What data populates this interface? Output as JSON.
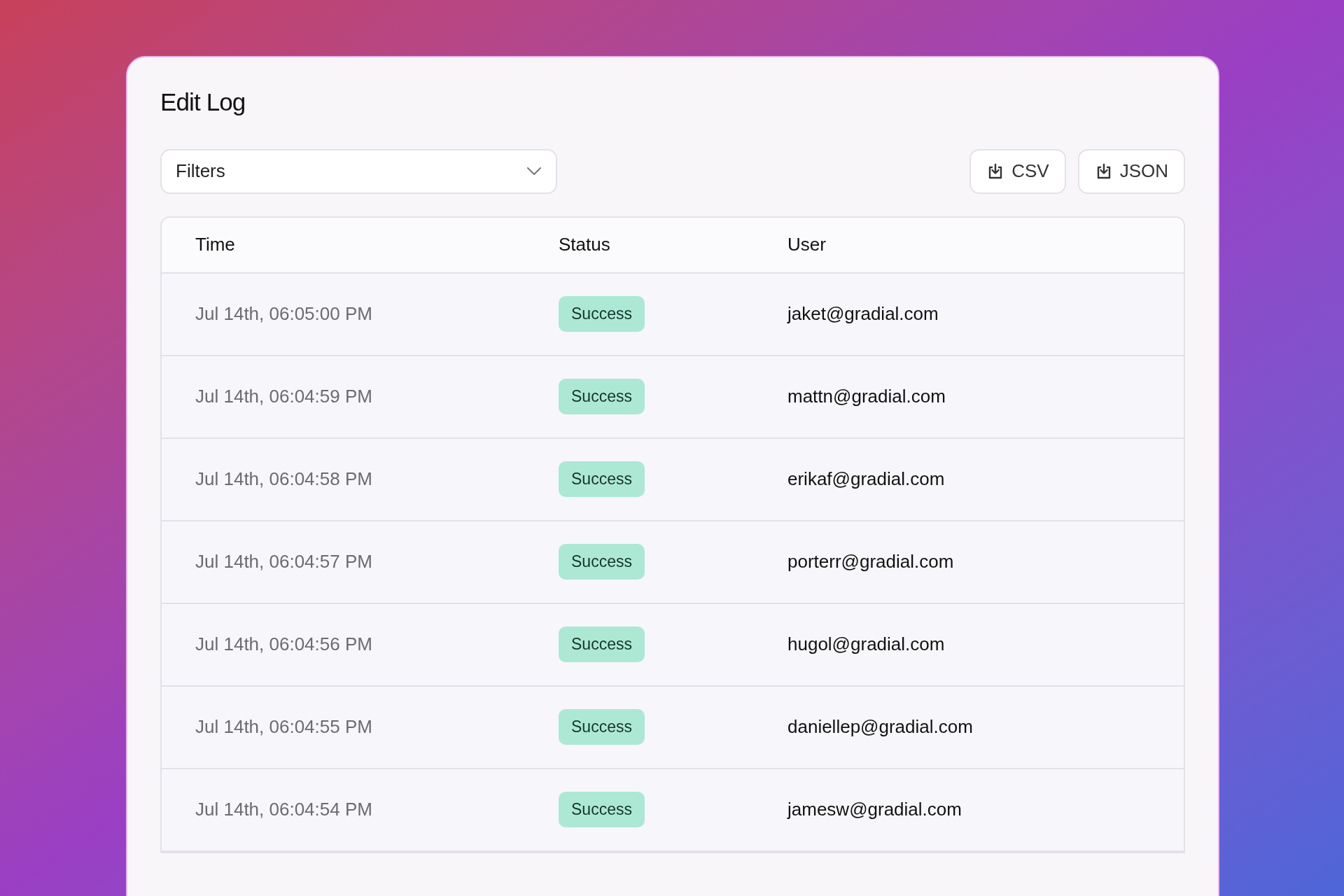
{
  "title": "Edit Log",
  "filters": {
    "label": "Filters"
  },
  "export_buttons": [
    {
      "label": "CSV"
    },
    {
      "label": "JSON"
    }
  ],
  "table": {
    "columns": [
      "Time",
      "Status",
      "User"
    ],
    "rows": [
      {
        "time": "Jul 14th, 06:05:00 PM",
        "status": "Success",
        "user": "jaket@gradial.com"
      },
      {
        "time": "Jul 14th, 06:04:59 PM",
        "status": "Success",
        "user": "mattn@gradial.com"
      },
      {
        "time": "Jul 14th, 06:04:58 PM",
        "status": "Success",
        "user": "erikaf@gradial.com"
      },
      {
        "time": "Jul 14th, 06:04:57 PM",
        "status": "Success",
        "user": "porterr@gradial.com"
      },
      {
        "time": "Jul 14th, 06:04:56 PM",
        "status": "Success",
        "user": "hugol@gradial.com"
      },
      {
        "time": "Jul 14th, 06:04:55 PM",
        "status": "Success",
        "user": "daniellep@gradial.com"
      },
      {
        "time": "Jul 14th, 06:04:54 PM",
        "status": "Success",
        "user": "jamesw@gradial.com"
      }
    ]
  }
}
